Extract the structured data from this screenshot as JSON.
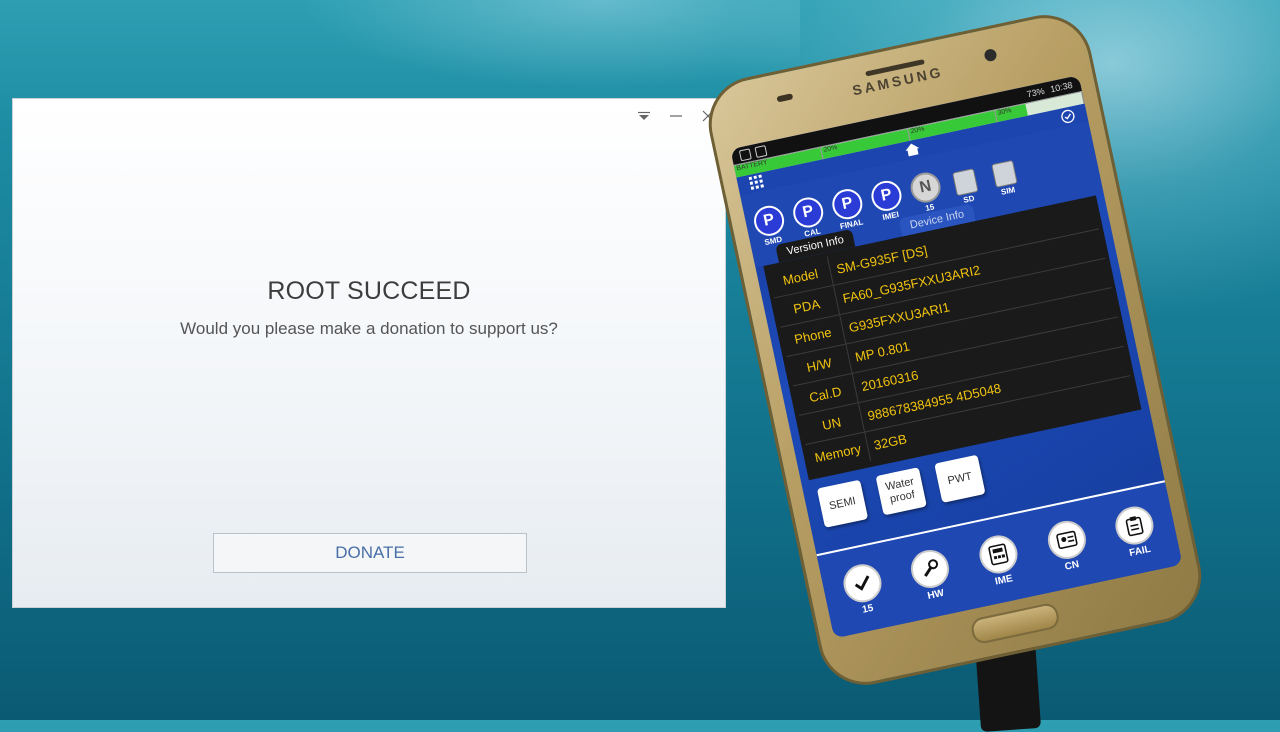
{
  "dialog": {
    "title": "ROOT SUCCEED",
    "message": "Would you please make a donation to support us?",
    "donate_label": "DONATE"
  },
  "phone": {
    "brand": "SAMSUNG",
    "status": {
      "battery": "73%",
      "time": "10:38"
    },
    "gauges": [
      {
        "label": "BATTERY",
        "fill_percent": 100
      },
      {
        "label": "20%",
        "fill_percent": 100
      },
      {
        "label": "20%",
        "fill_percent": 100
      },
      {
        "label": "30%",
        "fill_percent": 35
      }
    ],
    "badges": [
      {
        "letter": "P",
        "label": "SMD"
      },
      {
        "letter": "P",
        "label": "CAL"
      },
      {
        "letter": "P",
        "label": "FINAL"
      },
      {
        "letter": "P",
        "label": "IMEI"
      },
      {
        "letter": "N",
        "label": "15"
      }
    ],
    "chips": [
      {
        "label": "SD"
      },
      {
        "label": "SIM"
      }
    ],
    "tabs": {
      "active": "Version Info",
      "inactive": "Device Info"
    },
    "info_rows": [
      {
        "label": "Model",
        "value": "SM-G935F [DS]"
      },
      {
        "label": "PDA",
        "value": "FA60_G935FXXU3ARI2"
      },
      {
        "label": "Phone",
        "value": "G935FXXU3ARI1"
      },
      {
        "label": "H/W",
        "value": "MP 0.801"
      },
      {
        "label": "Cal.D",
        "value": "20160316"
      },
      {
        "label": "UN",
        "value": "988678384955 4D5048"
      },
      {
        "label": "Memory",
        "value": "32GB"
      }
    ],
    "tests": [
      "SEMI",
      "Water proof",
      "PWT"
    ],
    "bottom_nav": [
      {
        "label": "15",
        "icon": "check-icon"
      },
      {
        "label": "HW",
        "icon": "wrench-icon"
      },
      {
        "label": "IME",
        "icon": "calculator-icon"
      },
      {
        "label": "CN",
        "icon": "contact-card-icon"
      },
      {
        "label": "FAIL",
        "icon": "clipboard-icon"
      }
    ]
  }
}
